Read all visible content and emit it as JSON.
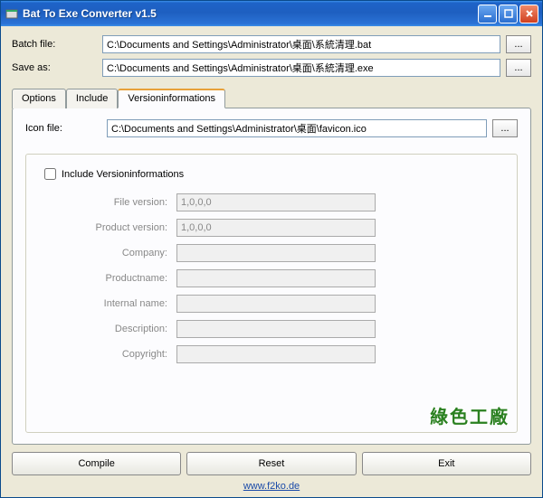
{
  "title": "Bat To Exe Converter v1.5",
  "batch_file": {
    "label": "Batch file:",
    "value": "C:\\Documents and Settings\\Administrator\\桌面\\系統清理.bat"
  },
  "save_as": {
    "label": "Save as:",
    "value": "C:\\Documents and Settings\\Administrator\\桌面\\系統清理.exe"
  },
  "tabs": {
    "options": "Options",
    "include": "Include",
    "versioninfo": "Versioninformations"
  },
  "icon_file": {
    "label": "Icon file:",
    "value": "C:\\Documents and Settings\\Administrator\\桌面\\favicon.ico"
  },
  "include_versioninfo": "Include Versioninformations",
  "fields": {
    "file_version": {
      "label": "File version:",
      "value": "1,0,0,0"
    },
    "product_version": {
      "label": "Product version:",
      "value": "1,0,0,0"
    },
    "company": {
      "label": "Company:",
      "value": ""
    },
    "productname": {
      "label": "Productname:",
      "value": ""
    },
    "internal_name": {
      "label": "Internal name:",
      "value": ""
    },
    "description": {
      "label": "Description:",
      "value": ""
    },
    "copyright": {
      "label": "Copyright:",
      "value": ""
    }
  },
  "buttons": {
    "compile": "Compile",
    "reset": "Reset",
    "exit": "Exit",
    "browse": "..."
  },
  "footer_link": "www.f2ko.de",
  "watermark": "綠色工廠"
}
